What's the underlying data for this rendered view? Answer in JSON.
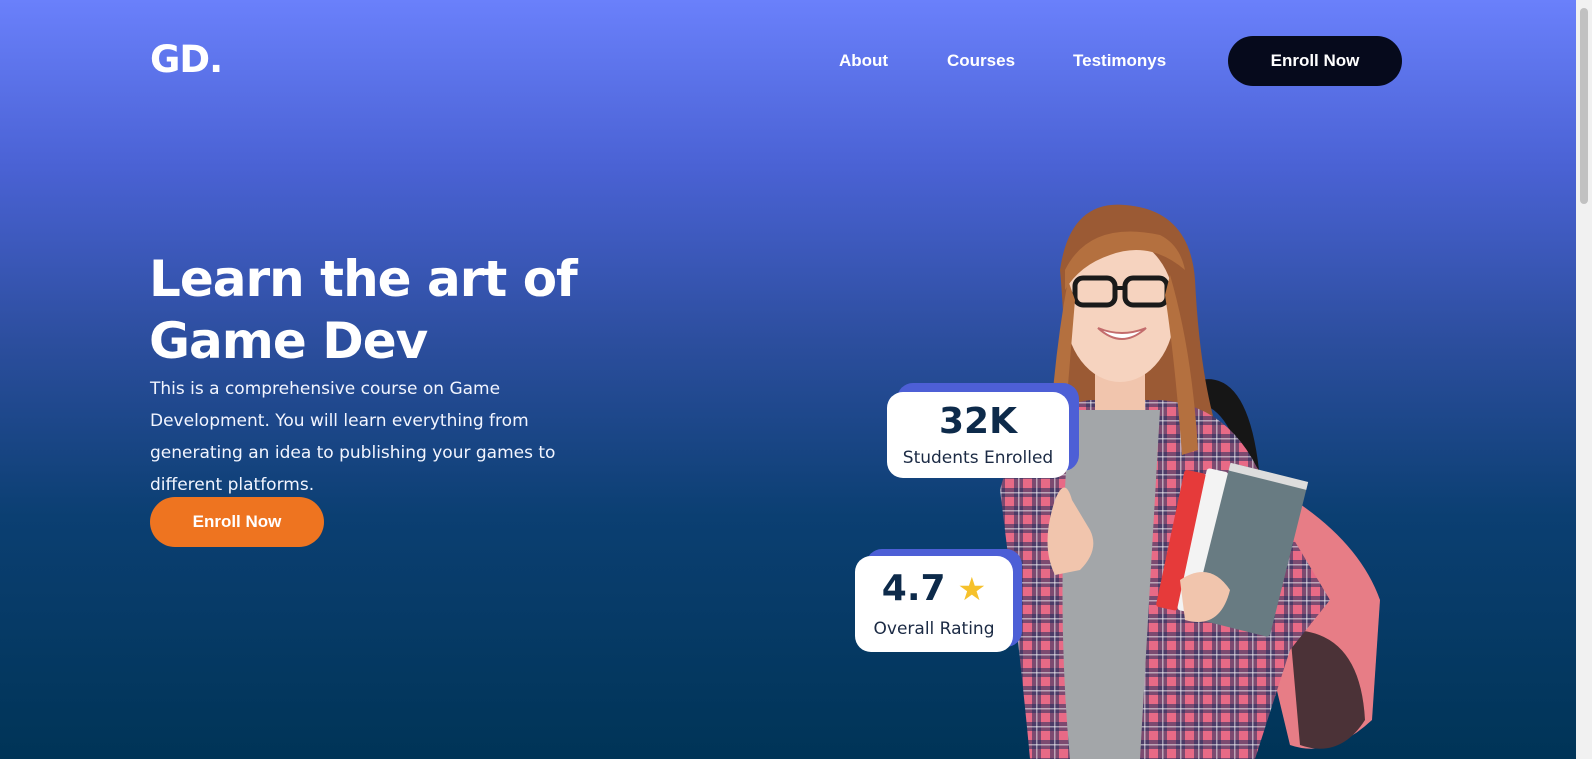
{
  "header": {
    "logo": "GD.",
    "nav": [
      {
        "label": "About"
      },
      {
        "label": "Courses"
      },
      {
        "label": "Testimonys"
      }
    ],
    "cta_label": "Enroll Now"
  },
  "hero": {
    "title_line1": "Learn the art of",
    "title_line2": "Game Dev",
    "description": "This is a comprehensive course on Game Development. You will learn everything from generating an idea to publishing your games to different platforms.",
    "cta_label": "Enroll Now"
  },
  "stats": {
    "students": {
      "value": "32K",
      "label": "Students Enrolled"
    },
    "rating": {
      "value": "4.7",
      "label": "Overall Rating",
      "icon": "star-icon"
    }
  },
  "colors": {
    "bg_top": "#6a80fb",
    "bg_bottom": "#003457",
    "cta_dark": "#060a1c",
    "cta_orange": "#ee7420",
    "card_accent": "#4d5fd6",
    "star": "#f6c12b"
  }
}
